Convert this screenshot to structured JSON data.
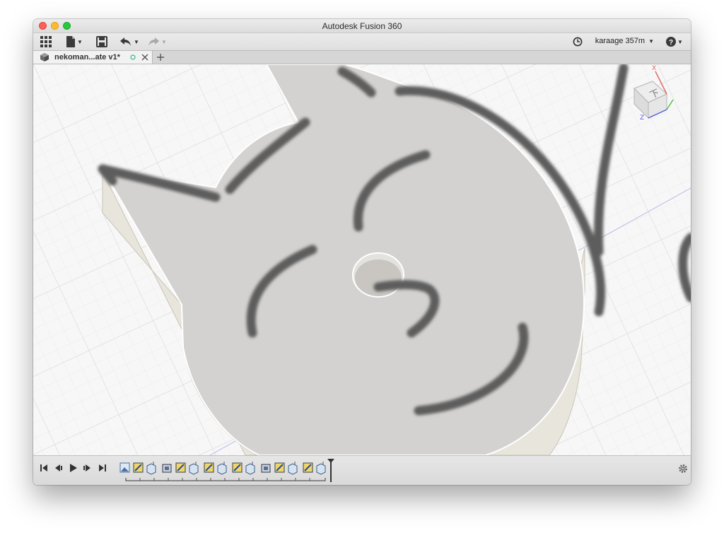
{
  "window": {
    "title": "Autodesk Fusion 360"
  },
  "toolbar": {
    "grid_icon": "grid-icon",
    "file_icon": "file-icon",
    "save_icon": "save-icon",
    "undo_icon": "undo-icon",
    "redo_icon": "redo-icon",
    "job_status_icon": "clock-icon",
    "user_label": "karaage 357m",
    "help_icon": "help-icon"
  },
  "tabs": [
    {
      "label": "nekoman...ate v1*",
      "icon": "component-icon"
    }
  ],
  "viewcube": {
    "face_label": "下",
    "axis_x": "X",
    "axis_z": "Z"
  },
  "timeline": {
    "playback_icons": [
      "skip-to-start-icon",
      "step-back-icon",
      "play-icon",
      "step-forward-icon",
      "skip-to-end-icon"
    ],
    "features": [
      "sketch",
      "extrude",
      "extrude-body",
      "component",
      "extrude",
      "extrude-body",
      "extrude",
      "extrude-body",
      "extrude",
      "extrude-body",
      "component",
      "extrude",
      "extrude-body",
      "extrude",
      "extrude-body"
    ],
    "settings_icon": "gear-icon"
  },
  "colors": {
    "model_face": "#d6d4d2",
    "model_side": "#e9e6dc",
    "marker_stroke": "#5c5c5c",
    "grid_line": "#e3e3e3"
  }
}
